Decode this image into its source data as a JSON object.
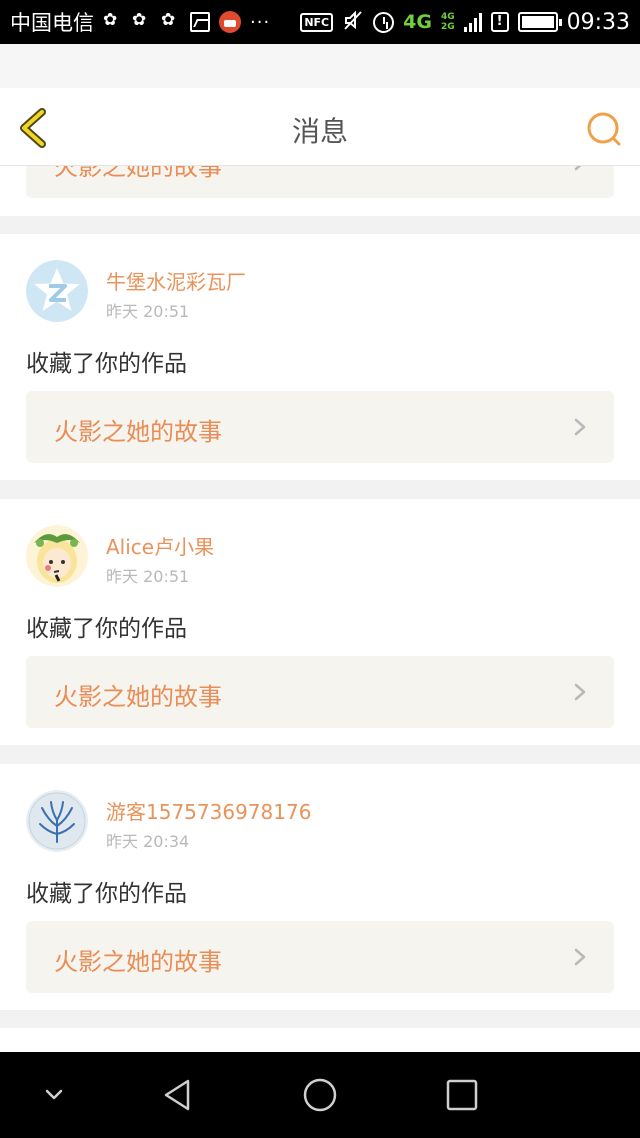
{
  "status_bar": {
    "carrier": "中国电信",
    "overflow": "···",
    "nfc": "NFC",
    "network_primary": "4G",
    "network_stack_top": "4G",
    "network_stack_bottom": "2G",
    "time": "09:33",
    "battery_level": 1.0,
    "icons": [
      "clover-icon",
      "clover-icon",
      "clover-icon",
      "image-icon",
      "app-notification-icon",
      "nfc-icon",
      "mute-icon",
      "alarm-icon",
      "signal-icon",
      "sim-alert-icon",
      "battery-icon"
    ]
  },
  "header": {
    "title": "消息",
    "back_icon": "chevron-left-icon",
    "search_icon": "search-icon",
    "accent_color": "#f0a04b"
  },
  "messages": [
    {
      "work_title": "火影之她的故事"
    },
    {
      "user_name": "牛堡水泥彩瓦厂",
      "time": "昨天 20:51",
      "action": "收藏了你的作品",
      "work_title": "火影之她的故事",
      "avatar": "default-avatar-icon"
    },
    {
      "user_name": "Alice卢小果",
      "time": "昨天 20:51",
      "action": "收藏了你的作品",
      "work_title": "火影之她的故事",
      "avatar": "anime-avatar-icon"
    },
    {
      "user_name": "游客1575736978176",
      "time": "昨天 20:34",
      "action": "收藏了你的作品",
      "work_title": "火影之她的故事",
      "avatar": "tree-avatar-icon"
    }
  ],
  "colors": {
    "name": "#e8935a",
    "work_title": "#ea8c55",
    "work_bg": "#f5f4ee",
    "page_bg": "#f2f2f2"
  },
  "nav_bar": {
    "icons": [
      "hide-keyboard-icon",
      "back-triangle-icon",
      "home-circle-icon",
      "recents-square-icon"
    ]
  }
}
